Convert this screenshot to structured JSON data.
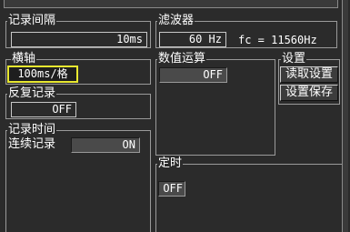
{
  "record_interval": {
    "title": "记录间隔",
    "value": "10ms"
  },
  "filter": {
    "title": "滤波器",
    "value": "60 Hz",
    "fc_text": "fc = 11560Hz"
  },
  "horizontal_axis": {
    "title": "横轴",
    "value": "100ms/格"
  },
  "numeric_calc": {
    "title": "数值运算",
    "value": "OFF"
  },
  "settings": {
    "title": "设置",
    "read_label": "读取设置",
    "save_label": "设置保存"
  },
  "repeat_record": {
    "title": "反复记录",
    "value": "OFF"
  },
  "record_time": {
    "title": "记录时间",
    "continuous_label": "连续记录",
    "continuous_value": "ON"
  },
  "timer": {
    "title": "定时",
    "value": "OFF"
  },
  "colors": {
    "background": "#2b2b2b",
    "highlight": "#e8e830"
  }
}
